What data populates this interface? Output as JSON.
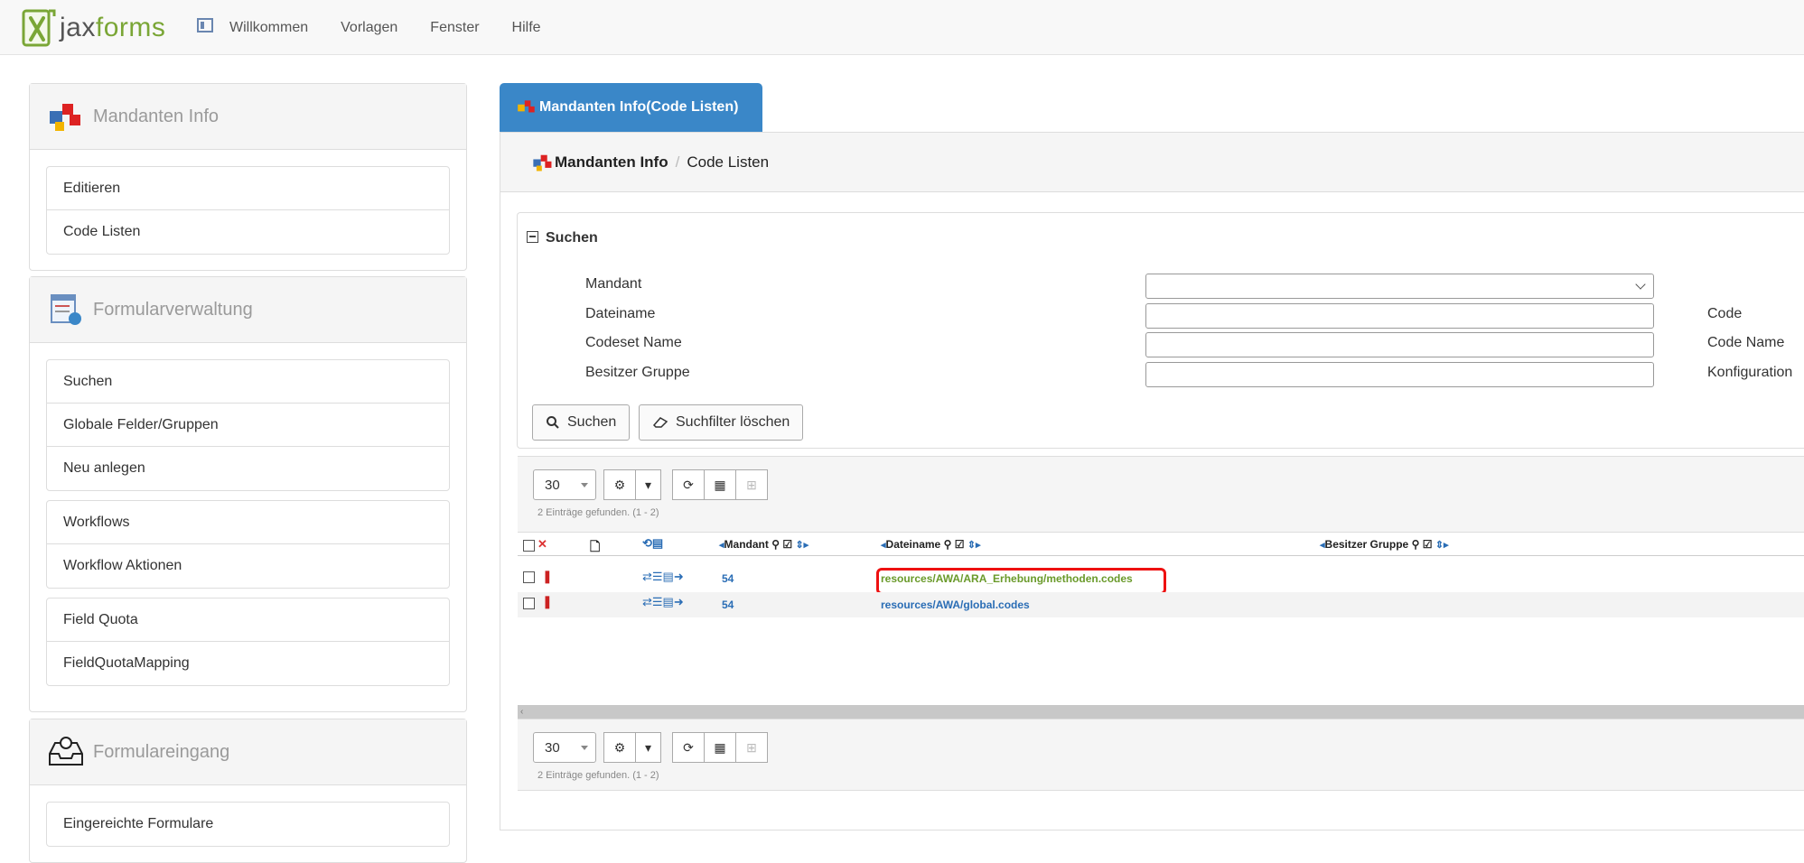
{
  "app": {
    "logo_text_a": "jax",
    "logo_text_b": "forms"
  },
  "nav": {
    "items": [
      "Willkommen",
      "Vorlagen",
      "Fenster",
      "Hilfe"
    ]
  },
  "sidebar": {
    "mandanten": {
      "title": "Mandanten Info",
      "groups": [
        [
          "Editieren",
          "Code Listen"
        ]
      ]
    },
    "formular": {
      "title": "Formularverwaltung",
      "groups": [
        [
          "Suchen",
          "Globale Felder/Gruppen",
          "Neu anlegen"
        ],
        [
          "Workflows",
          "Workflow Aktionen"
        ],
        [
          "Field Quota",
          "FieldQuotaMapping"
        ]
      ]
    },
    "eingang": {
      "title": "Formulareingang",
      "groups": [
        [
          "Eingereichte Formulare"
        ]
      ]
    }
  },
  "tab": {
    "label": "Mandanten Info(Code Listen)"
  },
  "breadcrumb": {
    "first": "Mandanten Info",
    "separator": "/",
    "second": "Code Listen"
  },
  "search": {
    "title": "Suchen",
    "fields": [
      {
        "label": "Mandant",
        "value": "",
        "right_label": ""
      },
      {
        "label": "Dateiname",
        "value": "",
        "right_label": "Code"
      },
      {
        "label": "Codeset Name",
        "value": "",
        "right_label": "Code Name"
      },
      {
        "label": "Besitzer Gruppe",
        "value": "",
        "right_label": "Konfiguration"
      }
    ],
    "search_button": "Suchen",
    "clear_button": "Suchfilter löschen"
  },
  "grid": {
    "page_size": "30",
    "found_text": "2 Einträge gefunden. (1 - 2)",
    "columns": [
      "Mandant",
      "Dateiname",
      "Besitzer Gruppe"
    ],
    "rows": [
      {
        "mandant": "54",
        "dateiname": "resources/AWA/ARA_Erhebung/methoden.codes",
        "besitzer": ""
      },
      {
        "mandant": "54",
        "dateiname": "resources/AWA/global.codes",
        "besitzer": ""
      }
    ]
  },
  "colors": {
    "accent": "#3a87c8",
    "link": "#2a6db5",
    "highlight": "#ee1111",
    "brand_green": "#7aa636"
  }
}
